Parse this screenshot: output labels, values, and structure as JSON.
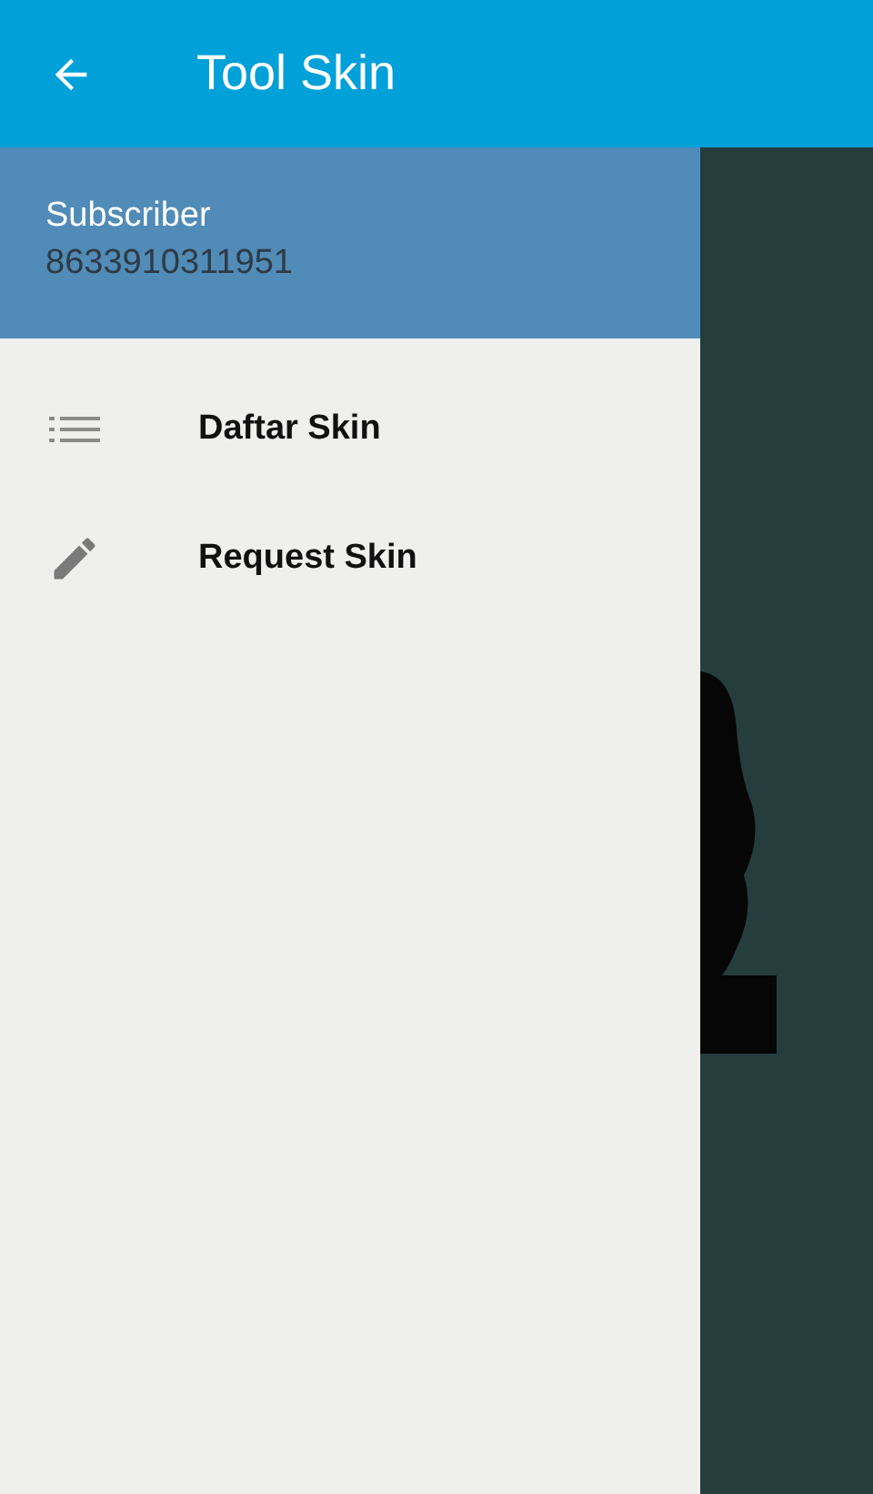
{
  "app_bar": {
    "title": "Tool Skin"
  },
  "drawer": {
    "header": {
      "label": "Subscriber",
      "value": "8633910311951"
    },
    "items": [
      {
        "kind": "list",
        "label": "Daftar Skin"
      },
      {
        "kind": "edit",
        "label": "Request Skin"
      }
    ]
  }
}
